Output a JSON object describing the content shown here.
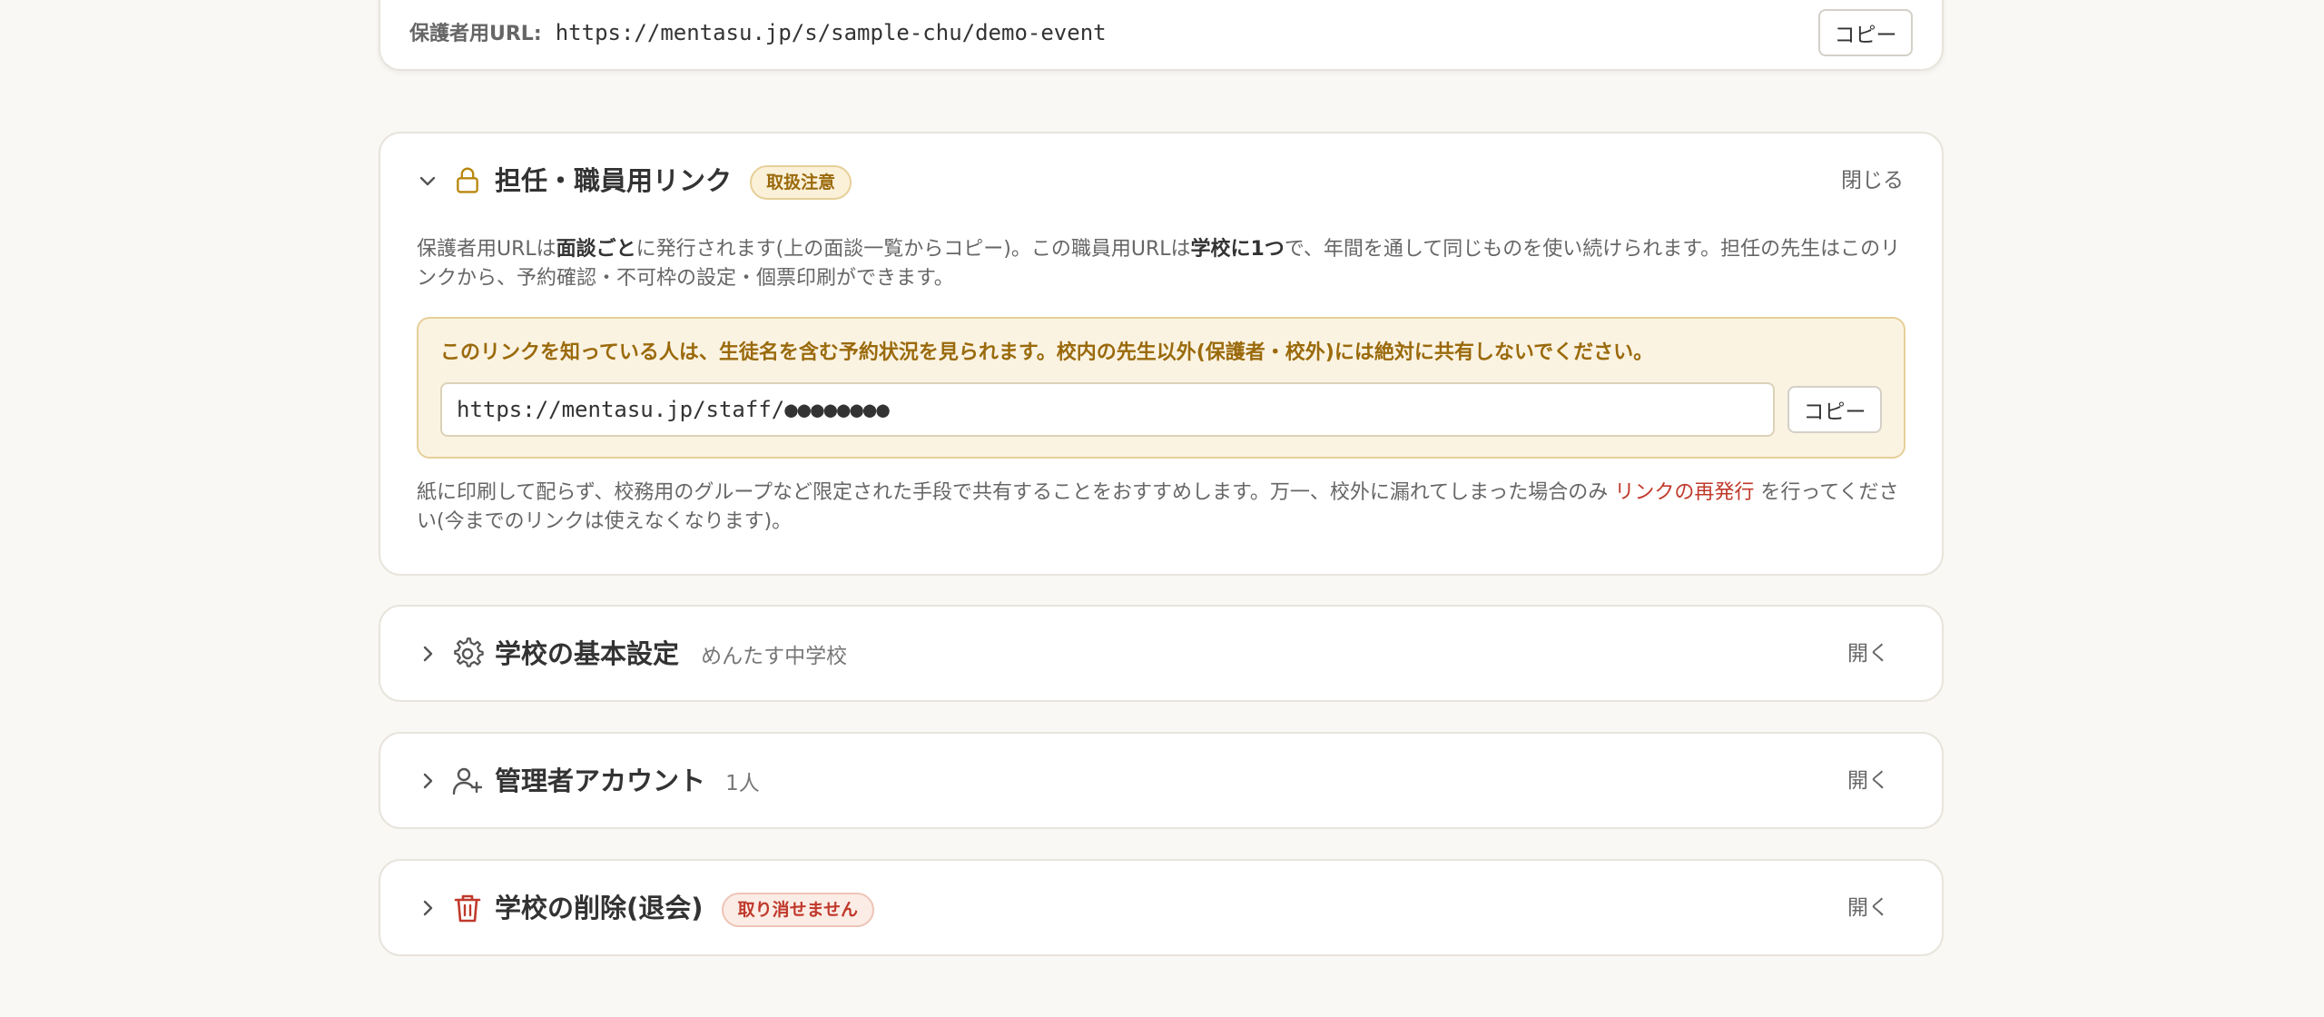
{
  "parent_url": {
    "label": "保護者用URL:",
    "url": "https://mentasu.jp/s/sample-chu/demo-event",
    "copy_label": "コピー"
  },
  "staff_section": {
    "title": "担任・職員用リンク",
    "badge": "取扱注意",
    "action": "閉じる",
    "desc": {
      "p1": "保護者用URLは",
      "b1": "面談ごと",
      "p2": "に発行されます(上の面談一覧からコピー)。この職員用URLは",
      "b2": "学校に1つ",
      "p3": "で、年間を通して同じものを使い続けられます。担任の先生はこのリンクから、予約確認・不可枠の設定・個票印刷ができます。"
    },
    "warning": "このリンクを知っている人は、生徒名を含む予約状況を見られます。校内の先生以外(保護者・校外)には絶対に共有しないでください。",
    "staff_url": "https://mentasu.jp/staff/●●●●●●●●",
    "copy_label": "コピー",
    "note": {
      "p1": "紙に印刷して配らず、校務用のグループなど限定された手段で共有することをおすすめします。万一、校外に漏れてしまった場合のみ ",
      "link": "リンクの再発行",
      "p2": " を行ってください(今までのリンクは使えなくなります)。"
    }
  },
  "basic_section": {
    "title": "学校の基本設定",
    "subtitle": "めんたす中学校",
    "action": "開く"
  },
  "admin_section": {
    "title": "管理者アカウント",
    "subtitle": "1人",
    "action": "開く"
  },
  "delete_section": {
    "title": "学校の削除(退会)",
    "badge": "取り消せません",
    "action": "開く"
  },
  "colors": {
    "background": "#faf8f4",
    "warning_bg": "#fbf3e2",
    "warning_border": "#e6cf98",
    "warning_text": "#9a6a0c",
    "danger": "#c0392b",
    "link": "#c0392b"
  },
  "icons": {
    "staff": "lock-icon",
    "basic": "gear-icon",
    "admin": "user-plus-icon",
    "delete": "trash-icon",
    "open": "chevron-right-icon",
    "close": "chevron-down-icon"
  }
}
